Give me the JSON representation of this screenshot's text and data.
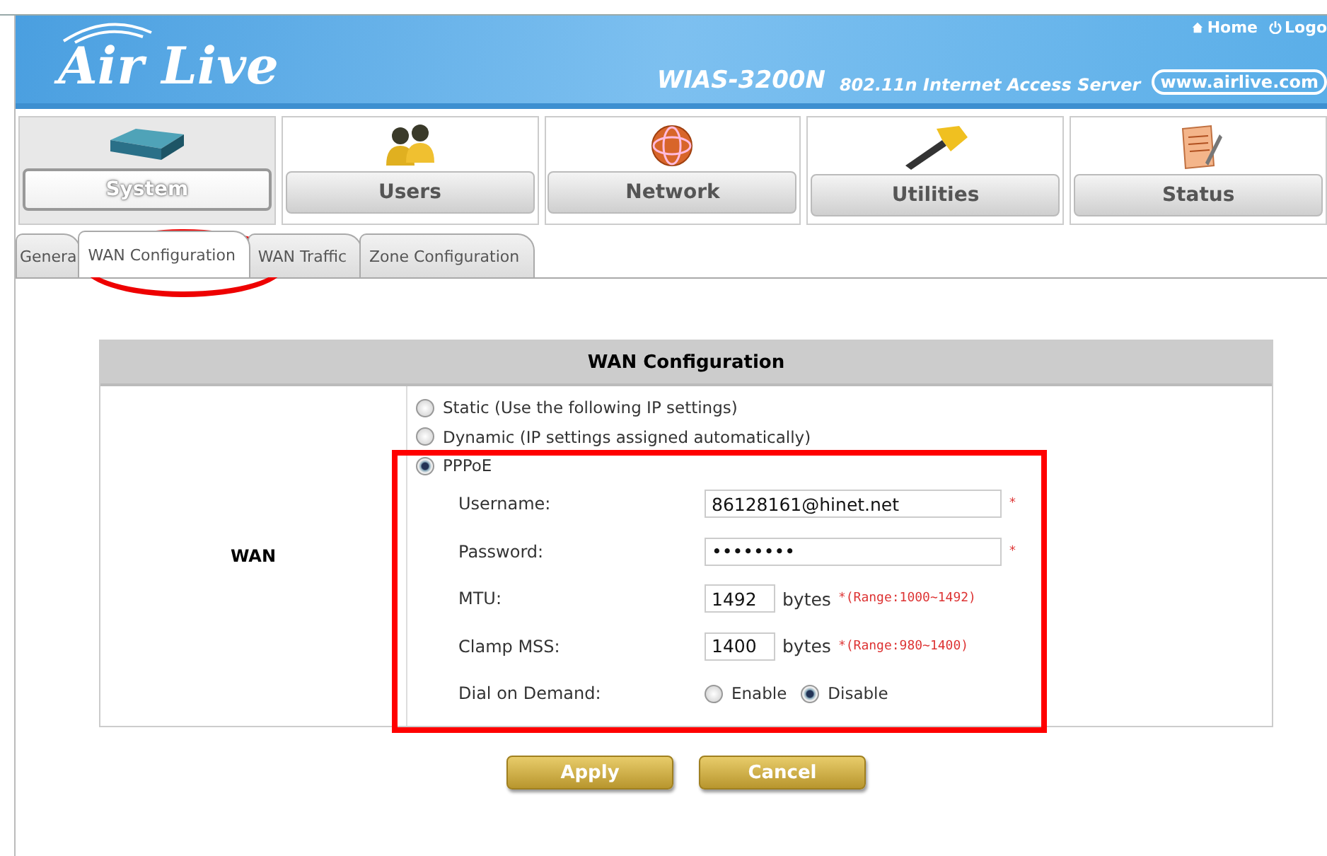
{
  "header": {
    "brand": "Air Live",
    "model": "WIAS-3200N",
    "subtitle": "802.11n Internet Access Server",
    "website": "www.airlive.com",
    "links": [
      {
        "label": "Home",
        "kind": "home"
      },
      {
        "label": "Logo",
        "kind": "logout"
      }
    ]
  },
  "nav": [
    {
      "label": "System",
      "kind": "device",
      "selected": true
    },
    {
      "label": "Users",
      "kind": "users",
      "selected": false
    },
    {
      "label": "Network",
      "kind": "globe",
      "selected": false
    },
    {
      "label": "Utilities",
      "kind": "hammer",
      "selected": false
    },
    {
      "label": "Status",
      "kind": "notes",
      "selected": false
    }
  ],
  "subtabs": [
    {
      "label": "Genera",
      "selected": false
    },
    {
      "label": "WAN Configuration",
      "selected": true
    },
    {
      "label": "WAN Traffic",
      "selected": false
    },
    {
      "label": "Zone Configuration",
      "selected": false
    }
  ],
  "panel": {
    "title": "WAN Configuration",
    "row_label": "WAN",
    "modes": [
      {
        "label": "Static (Use the following IP settings)",
        "selected": false
      },
      {
        "label": "Dynamic (IP settings assigned automatically)",
        "selected": false
      },
      {
        "label": "PPPoE",
        "selected": true
      }
    ],
    "fields": [
      {
        "kind": "text",
        "label": "Username:",
        "value": "86128161@hinet.net",
        "required": "*"
      },
      {
        "kind": "text",
        "label": "Password:",
        "value": "••••••••",
        "required": "*"
      },
      {
        "kind": "number",
        "label": "MTU:",
        "value": "1492",
        "unit": "bytes",
        "required": "*(Range:1000~1492)"
      },
      {
        "kind": "number",
        "label": "Clamp MSS:",
        "value": "1400",
        "unit": "bytes",
        "required": "*(Range:980~1400)"
      },
      {
        "kind": "choice",
        "label": "Dial on Demand:",
        "options": [
          {
            "label": "Enable",
            "selected": false
          },
          {
            "label": "Disable",
            "selected": true
          }
        ]
      }
    ]
  },
  "buttons": [
    "Apply",
    "Cancel"
  ]
}
